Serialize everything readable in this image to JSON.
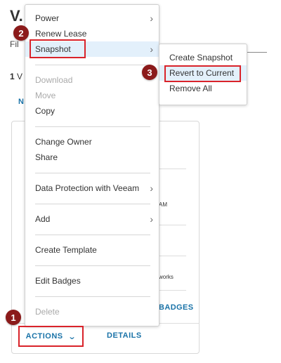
{
  "background": {
    "title": "V.",
    "filter_label": "Fil",
    "count": "1",
    "count_suffix": "V",
    "new_label": "N",
    "card_texts": [
      "AM",
      "works"
    ],
    "badges_label": "BADGES",
    "actions_label": "ACTIONS",
    "details_label": "DETAILS"
  },
  "menu": {
    "items": [
      {
        "label": "Power",
        "submenu": true,
        "disabled": false
      },
      {
        "label": "Renew Lease",
        "submenu": false,
        "disabled": false
      },
      {
        "label": "Snapshot",
        "submenu": true,
        "disabled": false,
        "active": true
      },
      {
        "label": "Download",
        "submenu": false,
        "disabled": true
      },
      {
        "label": "Move",
        "submenu": false,
        "disabled": true
      },
      {
        "label": "Copy",
        "submenu": false,
        "disabled": false
      },
      {
        "label": "Change Owner",
        "submenu": false,
        "disabled": false
      },
      {
        "label": "Share",
        "submenu": false,
        "disabled": false
      },
      {
        "label": "Data Protection with Veeam",
        "submenu": true,
        "disabled": false
      },
      {
        "label": "Add",
        "submenu": true,
        "disabled": false
      },
      {
        "label": "Create Template",
        "submenu": false,
        "disabled": false
      },
      {
        "label": "Edit Badges",
        "submenu": false,
        "disabled": false
      },
      {
        "label": "Delete",
        "submenu": false,
        "disabled": true
      }
    ]
  },
  "submenu": {
    "items": [
      {
        "label": "Create Snapshot"
      },
      {
        "label": "Revert to Current",
        "active": true
      },
      {
        "label": "Remove All"
      }
    ]
  },
  "steps": [
    "1",
    "2",
    "3"
  ],
  "colors": {
    "highlight": "#d9232a",
    "step_badge": "#8b1a1a",
    "link_blue": "#1a73a8",
    "active_bg": "#e3f0fb"
  }
}
